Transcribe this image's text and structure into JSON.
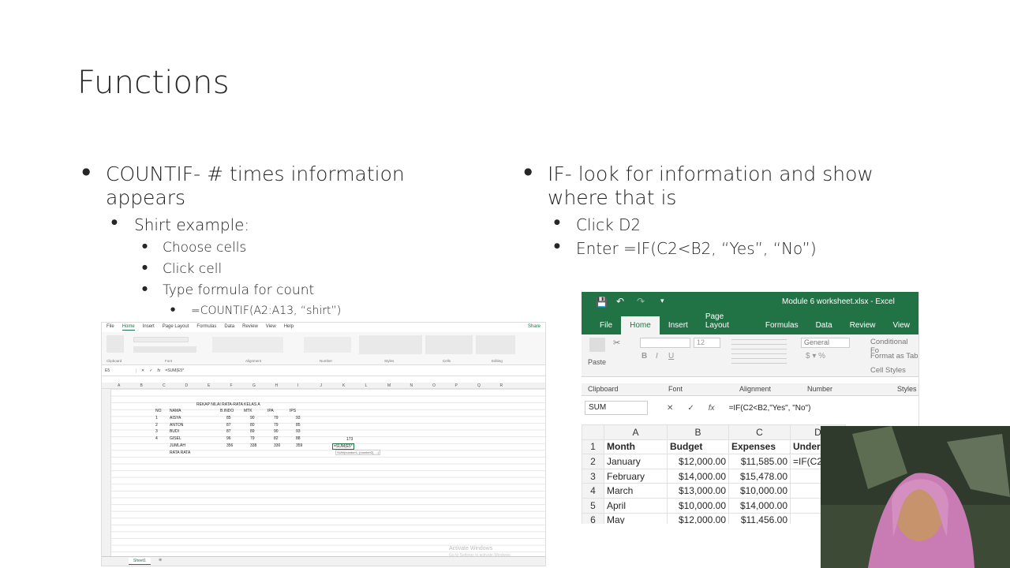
{
  "slide": {
    "title": "Functions",
    "left": {
      "b1": "COUNTIF- # times information appears",
      "b2": "Shirt example:",
      "b3": [
        "Choose cells",
        "Click cell",
        "Type formula for count"
      ],
      "b4": "=COUNTIF(A2:A13, “shirt”)"
    },
    "right": {
      "b1": "IF- look for information and show where that is",
      "b2": [
        "Click D2",
        "Enter =IF(C2<B2, “Yes”, “No”)"
      ]
    }
  },
  "small_excel": {
    "menu": [
      "File",
      "Home",
      "Insert",
      "Page Layout",
      "Formulas",
      "Data",
      "Review",
      "View",
      "Help"
    ],
    "share": "Share",
    "groups": [
      "Clipboard",
      "Font",
      "Alignment",
      "Number",
      "Styles",
      "Cells",
      "Editing"
    ],
    "namebox": "E5",
    "formula": "=SUM(E5*",
    "columns": [
      "A",
      "B",
      "C",
      "D",
      "E",
      "F",
      "G",
      "H",
      "I",
      "J",
      "K",
      "L",
      "M",
      "N",
      "O",
      "P",
      "Q",
      "R"
    ],
    "sheet_title": "REKAP NILAI RATA-RATA KELAS A",
    "headers": [
      "NO",
      "NAMA",
      "B.INDO",
      "MTK",
      "IPA",
      "IPS"
    ],
    "rows": [
      [
        "1",
        "AISYA",
        "85",
        "90",
        "79",
        "93"
      ],
      [
        "2",
        "ANTON",
        "87",
        "80",
        "79",
        "85"
      ],
      [
        "3",
        "BUDI",
        "87",
        "89",
        "90",
        "93"
      ],
      [
        "4",
        "GISEL",
        "96",
        "79",
        "82",
        "88"
      ]
    ],
    "jumlah": [
      "JUMLAH",
      "356",
      "338",
      "330",
      "359"
    ],
    "rata": "RATA RATA",
    "side_value": "173",
    "side_formula": "=SUM(E5*",
    "tooltip": "SUM(number1, [number2], ...)",
    "sheet_tab": "Sheet1",
    "watermark1": "Activate Windows",
    "watermark2": "Go to Settings to activate Windows."
  },
  "big_excel": {
    "file_title": "Module 6 worksheet.xlsx  -  Excel",
    "tabs": [
      "File",
      "Home",
      "Insert",
      "Page Layout",
      "Formulas",
      "Data",
      "Review",
      "View"
    ],
    "paste": "Paste",
    "font_size": "12",
    "number_format": "General",
    "styles": [
      "Conditional Fo",
      "Format as Tab",
      "Cell Styles"
    ],
    "groups": [
      "Clipboard",
      "Font",
      "Alignment",
      "Number",
      "Styles"
    ],
    "namebox": "SUM",
    "formula": "=IF(C2<B2,\"Yes\", \"No\")",
    "fx": "fx",
    "col_headers": [
      "A",
      "B",
      "C",
      "D"
    ],
    "rows": [
      {
        "n": "1",
        "a": "Month",
        "b": "Budget",
        "c": "Expenses",
        "d": "Under"
      },
      {
        "n": "2",
        "a": "January",
        "b": "$12,000.00",
        "c": "$11,585.00",
        "d": "=IF(C2"
      },
      {
        "n": "3",
        "a": "February",
        "b": "$14,000.00",
        "c": "$15,478.00",
        "d": ""
      },
      {
        "n": "4",
        "a": "March",
        "b": "$13,000.00",
        "c": "$10,000.00",
        "d": ""
      },
      {
        "n": "5",
        "a": "April",
        "b": "$10,000.00",
        "c": "$14,000.00",
        "d": ""
      },
      {
        "n": "6",
        "a": "May",
        "b": "$12,000.00",
        "c": "$11,456.00",
        "d": ""
      }
    ]
  },
  "colors": {
    "excel_green": "#217346",
    "text": "#262626"
  }
}
